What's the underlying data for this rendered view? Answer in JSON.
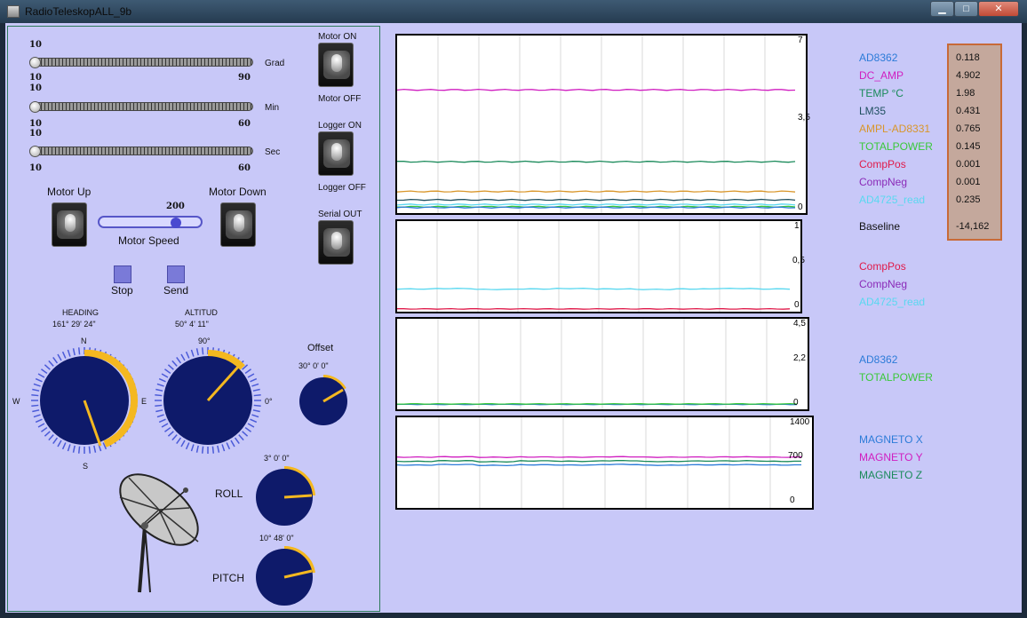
{
  "window": {
    "title": "RadioTeleskopALL_9b",
    "min": "▁",
    "max": "□",
    "close": "✕"
  },
  "sliders": [
    {
      "min": "10",
      "max": "90",
      "unit": "Grad",
      "value": 10
    },
    {
      "min": "10",
      "max": "60",
      "unit": "Min",
      "value": 10
    },
    {
      "min": "10",
      "max": "60",
      "unit": "Sec",
      "value": 10
    }
  ],
  "switches": {
    "motor_on": "Motor ON",
    "motor_off": "Motor OFF",
    "logger_on": "Logger ON",
    "logger_off": "Logger OFF",
    "serial_out": "Serial OUT"
  },
  "motor": {
    "up": "Motor Up",
    "down": "Motor Down",
    "speed_label": "Motor Speed",
    "speed_value": "200",
    "speed_fraction": 0.75
  },
  "buttons": {
    "stop": "Stop",
    "send": "Send"
  },
  "heading": {
    "title": "HEADING",
    "value": "161° 29' 24\"",
    "n": "N",
    "s": "S",
    "e": "E",
    "w": "W"
  },
  "altitude": {
    "title": "ALTITUD",
    "value": "50° 4' 11\"",
    "top": "90°",
    "right": "0°"
  },
  "offset": {
    "title": "Offset",
    "value": "30° 0' 0\""
  },
  "roll": {
    "title": "ROLL",
    "value": "3° 0' 0\""
  },
  "pitch": {
    "title": "PITCH",
    "value": "10° 48' 0\""
  },
  "charts": {
    "c1": {
      "ymax": "7",
      "ymid": "3,5",
      "ymin": "0"
    },
    "c2": {
      "ymax": "1",
      "ymid": "0,5",
      "ymin": "0"
    },
    "c3": {
      "ymax": "4,5",
      "ymid": "2,2",
      "ymin": "0"
    },
    "c4": {
      "ymax": "1400",
      "ymid": "700",
      "ymin": "0"
    }
  },
  "legend1": [
    {
      "name": "AD8362",
      "color": "#2c7bd8",
      "value": "0.118"
    },
    {
      "name": "DC_AMP",
      "color": "#d01ec0",
      "value": "4.902"
    },
    {
      "name": "TEMP °C",
      "color": "#1a8a5a",
      "value": "1.98"
    },
    {
      "name": "LM35",
      "color": "#1f4f5f",
      "value": "0.431"
    },
    {
      "name": "AMPL-AD8331",
      "color": "#d9962a",
      "value": "0.765"
    },
    {
      "name": "TOTALPOWER",
      "color": "#3ac83a",
      "value": "0.145"
    },
    {
      "name": "CompPos",
      "color": "#e01a4a",
      "value": "0.001"
    },
    {
      "name": "CompNeg",
      "color": "#8a2ab8",
      "value": "0.001"
    },
    {
      "name": "AD4725_read",
      "color": "#5ad8f0",
      "value": "0.235"
    }
  ],
  "baseline": {
    "label": "Baseline",
    "value": "-14,162"
  },
  "legend2": [
    {
      "name": "CompPos",
      "color": "#e01a4a"
    },
    {
      "name": "CompNeg",
      "color": "#8a2ab8"
    },
    {
      "name": "AD4725_read",
      "color": "#5ad8f0"
    }
  ],
  "legend3": [
    {
      "name": "AD8362",
      "color": "#2c7bd8"
    },
    {
      "name": "TOTALPOWER",
      "color": "#3ac83a"
    }
  ],
  "legend4": [
    {
      "name": "MAGNETO X",
      "color": "#2c7bd8"
    },
    {
      "name": "MAGNETO Y",
      "color": "#d01ec0"
    },
    {
      "name": "MAGNETO Z",
      "color": "#1a8a5a"
    }
  ],
  "chart_data": [
    {
      "type": "line",
      "ylim": [
        0,
        7
      ],
      "grid": true,
      "series": [
        {
          "name": "DC_AMP",
          "values": [
            4.9,
            4.9,
            4.9,
            4.9,
            4.9,
            4.9,
            4.9,
            4.9,
            4.9,
            4.9
          ]
        },
        {
          "name": "TEMP °C",
          "values": [
            1.98,
            1.98,
            1.98,
            1.98,
            1.98,
            1.98,
            1.98,
            1.98,
            1.98,
            1.98
          ]
        },
        {
          "name": "AMPL-AD8331",
          "values": [
            0.77,
            0.77,
            0.77,
            0.77,
            0.77,
            0.77,
            0.77,
            0.77,
            0.77,
            0.77
          ]
        },
        {
          "name": "LM35",
          "values": [
            0.43,
            0.43,
            0.43,
            0.43,
            0.43,
            0.43,
            0.43,
            0.43,
            0.43,
            0.43
          ]
        },
        {
          "name": "TOTALPOWER",
          "values": [
            0.15,
            0.15,
            0.15,
            0.15,
            0.15,
            0.15,
            0.15,
            0.15,
            0.15,
            0.15
          ]
        },
        {
          "name": "AD4725_read",
          "values": [
            0.24,
            0.24,
            0.24,
            0.24,
            0.24,
            0.24,
            0.24,
            0.24,
            0.24,
            0.24
          ]
        },
        {
          "name": "AD8362",
          "values": [
            0.12,
            0.12,
            0.12,
            0.12,
            0.12,
            0.12,
            0.12,
            0.12,
            0.12,
            0.12
          ]
        }
      ]
    },
    {
      "type": "line",
      "ylim": [
        0,
        1
      ],
      "grid": true,
      "series": [
        {
          "name": "AD4725_read",
          "values": [
            0.235,
            0.24,
            0.23,
            0.235,
            0.24,
            0.235,
            0.23,
            0.235,
            0.24,
            0.235
          ]
        },
        {
          "name": "CompPos",
          "values": [
            0.001,
            0.001,
            0.001,
            0.001,
            0.001,
            0.001,
            0.001,
            0.001,
            0.001,
            0.001
          ]
        }
      ]
    },
    {
      "type": "line",
      "ylim": [
        0,
        4.5
      ],
      "grid": true,
      "series": [
        {
          "name": "AD8362",
          "values": [
            0.12,
            0.12,
            0.12,
            0.12,
            0.12,
            0.12,
            0.12,
            0.12,
            0.12,
            0.12
          ]
        },
        {
          "name": "TOTALPOWER",
          "values": [
            0.145,
            0.145,
            0.145,
            0.145,
            0.145,
            0.145,
            0.145,
            0.145,
            0.145,
            0.145
          ]
        }
      ]
    },
    {
      "type": "line",
      "ylim": [
        0,
        1400
      ],
      "grid": true,
      "series": [
        {
          "name": "MAGNETO Y",
          "values": [
            790,
            795,
            788,
            792,
            790,
            796,
            789,
            791,
            794,
            790
          ]
        },
        {
          "name": "MAGNETO Z",
          "values": [
            720,
            730,
            715,
            728,
            722,
            732,
            718,
            726,
            729,
            721
          ]
        },
        {
          "name": "MAGNETO X",
          "values": [
            660,
            668,
            655,
            664,
            660,
            670,
            657,
            663,
            666,
            661
          ]
        }
      ]
    }
  ]
}
